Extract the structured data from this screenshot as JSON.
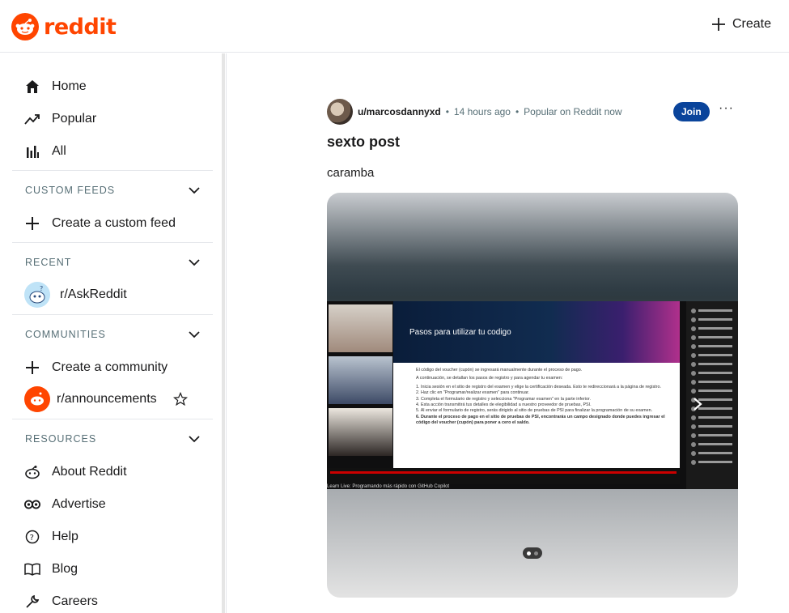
{
  "header": {
    "brand": "reddit",
    "create_label": "Create"
  },
  "sidebar": {
    "main_nav": [
      {
        "label": "Home",
        "icon": "home-icon"
      },
      {
        "label": "Popular",
        "icon": "trending-icon"
      },
      {
        "label": "All",
        "icon": "bar-chart-icon"
      }
    ],
    "custom_feeds": {
      "heading": "CUSTOM FEEDS",
      "create_label": "Create a custom feed"
    },
    "recent": {
      "heading": "RECENT",
      "items": [
        {
          "label": "r/AskReddit"
        }
      ]
    },
    "communities": {
      "heading": "COMMUNITIES",
      "create_label": "Create a community",
      "items": [
        {
          "label": "r/announcements"
        }
      ]
    },
    "resources": {
      "heading": "RESOURCES",
      "items": [
        {
          "label": "About Reddit",
          "icon": "reddit-icon"
        },
        {
          "label": "Advertise",
          "icon": "advertise-icon"
        },
        {
          "label": "Help",
          "icon": "help-icon"
        },
        {
          "label": "Blog",
          "icon": "book-icon"
        },
        {
          "label": "Careers",
          "icon": "wrench-icon"
        }
      ]
    }
  },
  "post": {
    "author": "u/marcosdannyxd",
    "time": "14 hours ago",
    "badge": "Popular on Reddit now",
    "join_label": "Join",
    "more_label": "···",
    "title": "sexto post",
    "body": "caramba",
    "media": {
      "slide_title": "Pasos para utilizar tu codigo",
      "slide_lines": [
        "El código del voucher (cupón) se ingresará manualmente durante el proceso de pago.",
        "A continuación, se detallan los pasos de registro y para agendar tu examen:",
        "1. Inicia sesión en el sitio de registro del examen y elige la certificación deseada. Esto te redireccionará a la página de registro.",
        "2. Haz clic en \"Programar/realizar examen\" para continuar.",
        "3. Completa el formulario de registro y selecciona \"Programar examen\" en la parte inferior.",
        "4. Esta acción transmitirá tus detalles de elegibilidad a nuestro proveedor de pruebas, PSI.",
        "5. Al enviar el formulario de registro, serás dirigido al sitio de pruebas de PSI para finalizar la programación de su examen.",
        "6. Durante el proceso de pago en el sitio de pruebas de PSI, encontrarás un campo designado donde puedes ingresar el código del voucher (cupón) para poner a cero el saldo."
      ],
      "caption": "Learn Live: Programando más rápido con GitHub Copilot",
      "pager_total": 2,
      "pager_active": 1
    }
  },
  "colors": {
    "brand": "#ff4500",
    "join": "#0a449b",
    "muted": "#576f76"
  }
}
